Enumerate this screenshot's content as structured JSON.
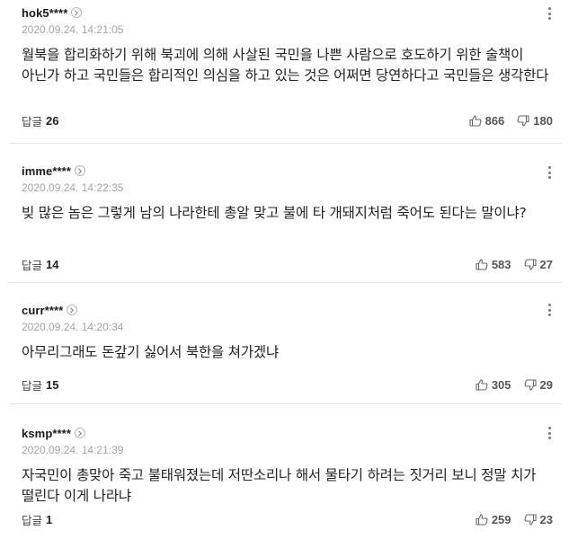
{
  "comments": [
    {
      "username": "hok5****",
      "timestamp": "2020.09.24. 14:21:05",
      "content": "월북을 합리화하기 위해 북괴에 의해 사살된 국민을 나쁜 사람으로 호도하기 위한 술책이 아닌가 하고 국민들은 합리적인 의심을 하고 있는 것은 어쩌면 당연하다고 국민들은 생각한다",
      "reply_label": "답글",
      "reply_count": "26",
      "likes": "866",
      "dislikes": "180"
    },
    {
      "username": "imme****",
      "timestamp": "2020.09.24. 14:22:35",
      "content": "빚 많은 놈은 그렇게 남의 나라한테 총알 맞고 불에 타 개돼지처럼 죽어도 된다는 말이냐?",
      "reply_label": "답글",
      "reply_count": "14",
      "likes": "583",
      "dislikes": "27"
    },
    {
      "username": "curr****",
      "timestamp": "2020.09.24. 14:20:34",
      "content": "아무리그래도 돈갚기 싫어서 북한을 쳐가겠냐",
      "reply_label": "답글",
      "reply_count": "15",
      "likes": "305",
      "dislikes": "29"
    },
    {
      "username": "ksmp****",
      "timestamp": "2020.09.24. 14:21:39",
      "content": "자국민이 총맞아 죽고 불태워졌는데 저딴소리나 해서 물타기 하려는 짓거리 보니 정말 치가 떨린다 이게 나라냐",
      "reply_label": "답글",
      "reply_count": "1",
      "likes": "259",
      "dislikes": "23"
    }
  ]
}
